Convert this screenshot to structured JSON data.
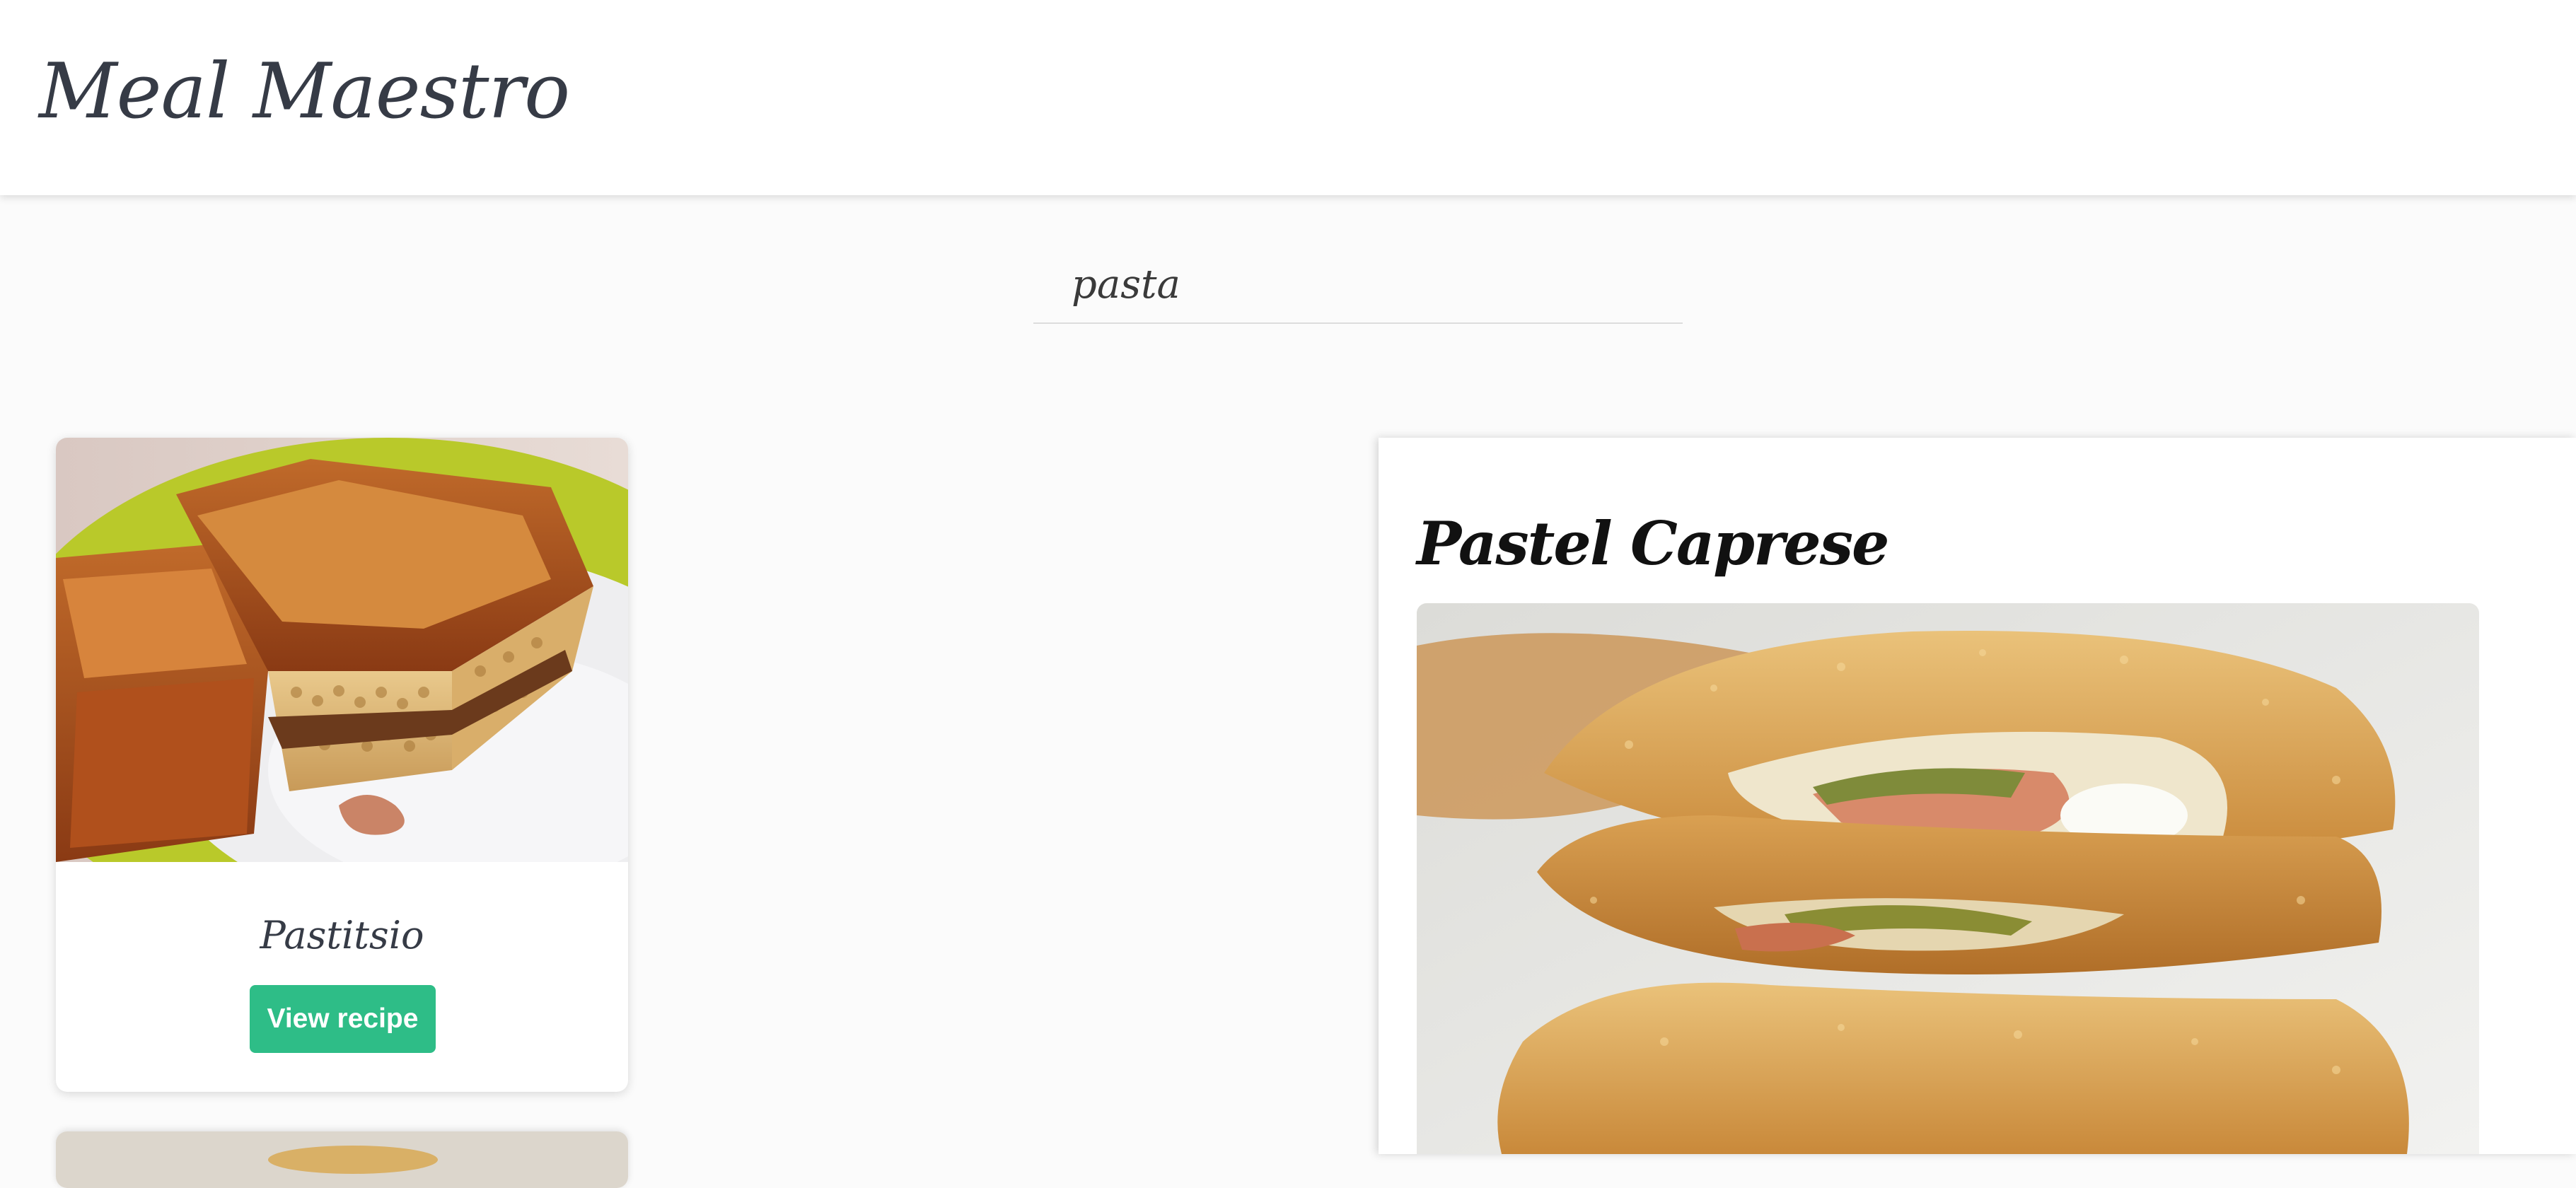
{
  "header": {
    "brand": "Meal Maestro"
  },
  "search": {
    "value": "pasta",
    "placeholder": ""
  },
  "results": [
    {
      "title": "Pastitsio",
      "button_label": "View recipe",
      "image": "pastitsio-photo"
    },
    {
      "image": "partially-visible-recipe-photo"
    }
  ],
  "detail": {
    "title": "Pastel Caprese",
    "image": "pastel-caprese-photo"
  },
  "colors": {
    "accent": "#2ebd87",
    "text": "#363b46",
    "header_bg": "#ffffff",
    "page_bg": "#fbfbfb"
  }
}
